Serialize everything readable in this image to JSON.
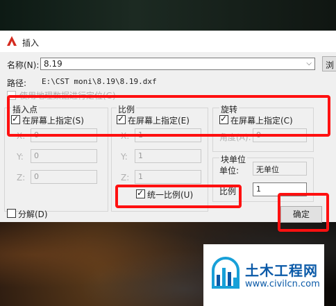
{
  "dialog": {
    "title": "插入",
    "name_label": "名称(N):",
    "name_value": "8.19",
    "browse_label": "浏览",
    "path_label": "路径:",
    "path_value": "E:\\CST  moni\\8.19\\8.19.dxf",
    "geo_label": "使用地理数据进行定位(G)"
  },
  "insertion": {
    "title": "插入点",
    "specify_label": "在屏幕上指定(S)",
    "specify_checked": true,
    "x_label": "X:",
    "x_value": "0",
    "y_label": "Y:",
    "y_value": "0",
    "z_label": "Z:",
    "z_value": "0"
  },
  "scale": {
    "title": "比例",
    "specify_label": "在屏幕上指定(E)",
    "specify_checked": true,
    "x_label": "X:",
    "x_value": "1",
    "y_label": "Y:",
    "y_value": "1",
    "z_label": "Z:",
    "z_value": "1",
    "uniform_label": "统一比例(U)",
    "uniform_checked": true
  },
  "rotation": {
    "title": "旋转",
    "specify_label": "在屏幕上指定(C)",
    "specify_checked": true,
    "angle_label": "角度(A):",
    "angle_value": "0"
  },
  "block_unit": {
    "title": "块单位",
    "unit_label": "单位:",
    "unit_value": "无单位",
    "factor_label": "比例",
    "factor_value": "1"
  },
  "explode": {
    "label": "分解(D)",
    "checked": false
  },
  "buttons": {
    "ok": "确定"
  },
  "watermark": {
    "title": "土木工程网",
    "url": "www.civilcn.com"
  },
  "colors": {
    "highlight": "#ff1010",
    "brand": "#0b5aa8",
    "app_icon": "#d42a1e"
  }
}
